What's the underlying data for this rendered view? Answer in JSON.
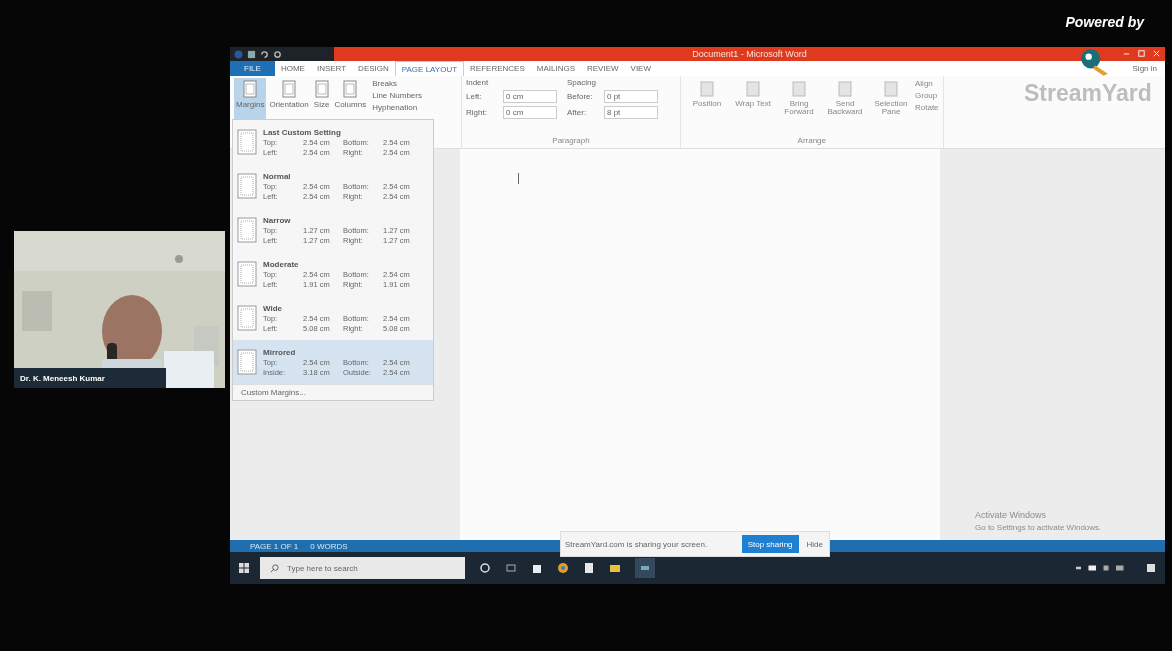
{
  "overlay": {
    "powered_by": "Powered by",
    "brand": "StreamYard"
  },
  "camera": {
    "kind": "picture",
    "name": "Dr. K. Meneesh Kumar"
  },
  "word": {
    "title": "Document1 - Microsoft Word",
    "tabs": [
      {
        "label": "FILE",
        "selected": false,
        "kind": "file"
      },
      {
        "label": "HOME",
        "selected": false,
        "kind": "tab"
      },
      {
        "label": "INSERT",
        "selected": false,
        "kind": "tab"
      },
      {
        "label": "DESIGN",
        "selected": false,
        "kind": "tab"
      },
      {
        "label": "PAGE LAYOUT",
        "selected": true,
        "kind": "tab"
      },
      {
        "label": "REFERENCES",
        "selected": false,
        "kind": "tab"
      },
      {
        "label": "MAILINGS",
        "selected": false,
        "kind": "tab"
      },
      {
        "label": "REVIEW",
        "selected": false,
        "kind": "tab"
      },
      {
        "label": "VIEW",
        "selected": false,
        "kind": "tab"
      }
    ],
    "sign_in": "Sign in",
    "setup_buttons": [
      {
        "label": "Margins",
        "selected": true
      },
      {
        "label": "Orientation",
        "selected": false
      },
      {
        "label": "Size",
        "selected": false
      },
      {
        "label": "Columns",
        "selected": false
      }
    ],
    "setup_items": [
      "Breaks",
      "Line Numbers",
      "Hyphenation"
    ],
    "indent": {
      "title": "Indent",
      "rows": [
        {
          "label": "Left:",
          "value": "0 cm"
        },
        {
          "label": "Right:",
          "value": "0 cm"
        }
      ]
    },
    "spacing": {
      "title": "Spacing",
      "rows": [
        {
          "label": "Before:",
          "value": "0 pt"
        },
        {
          "label": "After:",
          "value": "8 pt"
        }
      ]
    },
    "paragraph_label": "Paragraph",
    "arrange_buttons": [
      "Position",
      "Wrap Text",
      "Bring Forward",
      "Send Backward",
      "Selection Pane"
    ],
    "arrange_items": [
      "Align",
      "Group",
      "Rotate"
    ],
    "arrange_label": "Arrange",
    "status": [
      "PAGE 1 OF 1",
      "0 WORDS"
    ]
  },
  "margins_menu": {
    "options": [
      {
        "name": "Last Custom Setting",
        "selected": false,
        "rows": [
          [
            "Top:",
            "2.54 cm",
            "Bottom:",
            "2.54 cm"
          ],
          [
            "Left:",
            "2.54 cm",
            "Right:",
            "2.54 cm"
          ]
        ]
      },
      {
        "name": "Normal",
        "selected": false,
        "rows": [
          [
            "Top:",
            "2.54 cm",
            "Bottom:",
            "2.54 cm"
          ],
          [
            "Left:",
            "2.54 cm",
            "Right:",
            "2.54 cm"
          ]
        ]
      },
      {
        "name": "Narrow",
        "selected": false,
        "rows": [
          [
            "Top:",
            "1.27 cm",
            "Bottom:",
            "1.27 cm"
          ],
          [
            "Left:",
            "1.27 cm",
            "Right:",
            "1.27 cm"
          ]
        ]
      },
      {
        "name": "Moderate",
        "selected": false,
        "rows": [
          [
            "Top:",
            "2.54 cm",
            "Bottom:",
            "2.54 cm"
          ],
          [
            "Left:",
            "1.91 cm",
            "Right:",
            "1.91 cm"
          ]
        ]
      },
      {
        "name": "Wide",
        "selected": false,
        "rows": [
          [
            "Top:",
            "2.54 cm",
            "Bottom:",
            "2.54 cm"
          ],
          [
            "Left:",
            "5.08 cm",
            "Right:",
            "5.08 cm"
          ]
        ]
      },
      {
        "name": "Mirrored",
        "selected": true,
        "rows": [
          [
            "Top:",
            "2.54 cm",
            "Bottom:",
            "2.54 cm"
          ],
          [
            "Inside:",
            "3.18 cm",
            "Outside:",
            "2.54 cm"
          ]
        ]
      }
    ],
    "footer": "Custom Margins..."
  },
  "activation": {
    "title": "Activate Windows",
    "text": "Go to Settings to activate Windows."
  },
  "taskbar": {
    "search_placeholder": "Type here to search"
  },
  "share_bar": {
    "text": "StreamYard.com is sharing your screen.",
    "stop": "Stop sharing",
    "hide": "Hide"
  }
}
